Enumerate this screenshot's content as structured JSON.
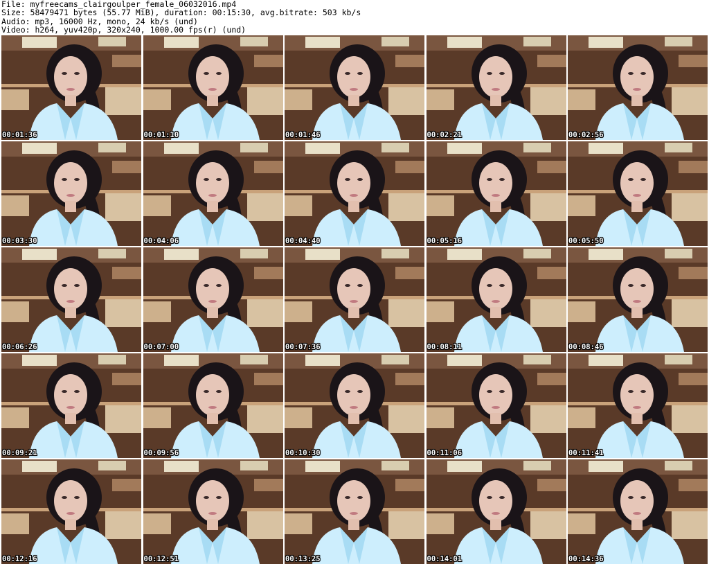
{
  "info": {
    "file": "File: myfreecams_clairgoulper_female_06032016.mp4",
    "size": "Size: 58479471 bytes (55.77 MiB), duration: 00:15:30, avg.bitrate: 503 kb/s",
    "audio": "Audio: mp3, 16000 Hz, mono, 24 kb/s (und)",
    "video": "Video: h264, yuv420p, 320x240, 1000.00 fps(r) (und)"
  },
  "thumbnails": [
    {
      "timestamp": "00:01:36"
    },
    {
      "timestamp": "00:01:10"
    },
    {
      "timestamp": "00:01:46"
    },
    {
      "timestamp": "00:02:21"
    },
    {
      "timestamp": "00:02:56"
    },
    {
      "timestamp": "00:03:30"
    },
    {
      "timestamp": "00:04:06"
    },
    {
      "timestamp": "00:04:40"
    },
    {
      "timestamp": "00:05:16"
    },
    {
      "timestamp": "00:05:50"
    },
    {
      "timestamp": "00:06:26"
    },
    {
      "timestamp": "00:07:00"
    },
    {
      "timestamp": "00:07:36"
    },
    {
      "timestamp": "00:08:11"
    },
    {
      "timestamp": "00:08:46"
    },
    {
      "timestamp": "00:09:21"
    },
    {
      "timestamp": "00:09:56"
    },
    {
      "timestamp": "00:10:30"
    },
    {
      "timestamp": "00:11:06"
    },
    {
      "timestamp": "00:11:41"
    },
    {
      "timestamp": "00:12:16"
    },
    {
      "timestamp": "00:12:51"
    },
    {
      "timestamp": "00:13:25"
    },
    {
      "timestamp": "00:14:01"
    },
    {
      "timestamp": "00:14:36"
    }
  ]
}
